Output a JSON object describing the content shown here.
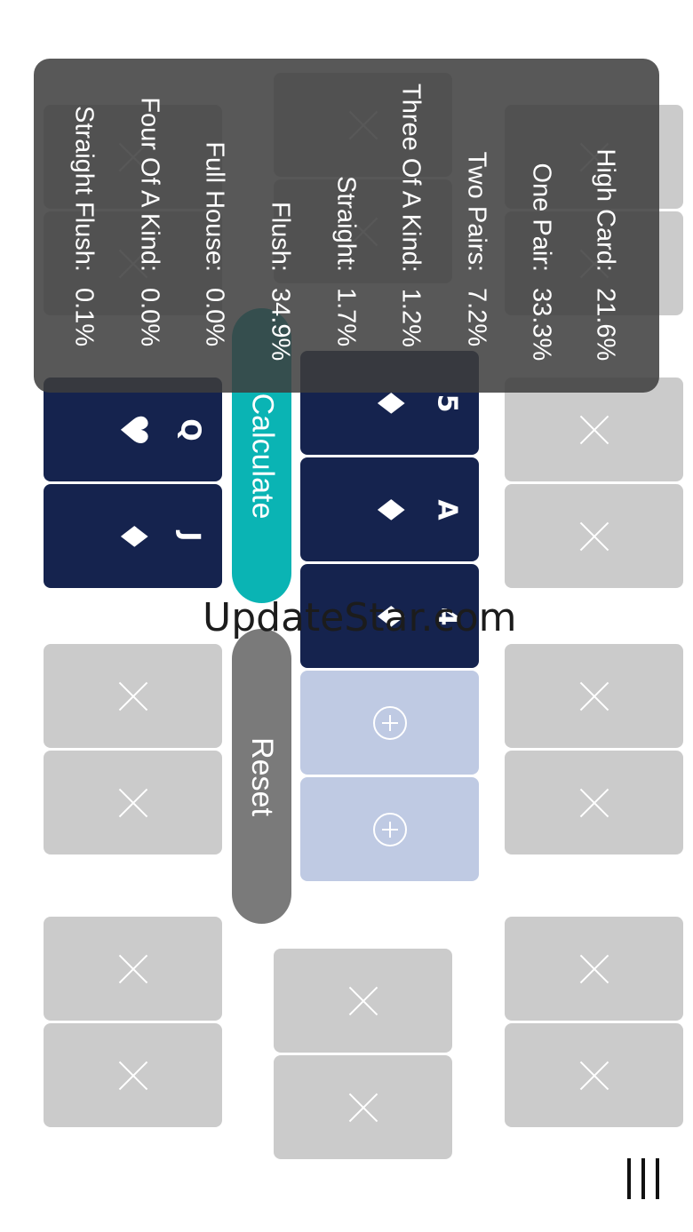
{
  "stats": {
    "rows": [
      {
        "label": "High Card:",
        "value": "21.6%"
      },
      {
        "label": "One Pair:",
        "value": "33.3%"
      },
      {
        "label": "Two Pairs:",
        "value": "7.2%"
      },
      {
        "label": "Three Of A Kind:",
        "value": "1.2%"
      },
      {
        "label": "Straight:",
        "value": "1.7%"
      },
      {
        "label": "Flush:",
        "value": "34.9%"
      },
      {
        "label": "Full House:",
        "value": "0.0%"
      },
      {
        "label": "Four Of A Kind:",
        "value": "0.0%"
      },
      {
        "label": "Straight Flush:",
        "value": "0.1%"
      }
    ]
  },
  "board": {
    "cards": [
      {
        "rank": "5",
        "suit": "♦"
      },
      {
        "rank": "A",
        "suit": "♦"
      },
      {
        "rank": "4",
        "suit": "♦"
      }
    ]
  },
  "hand": {
    "cards": [
      {
        "rank": "Q",
        "suit": "♥"
      },
      {
        "rank": "J",
        "suit": "♦"
      }
    ]
  },
  "buttons": {
    "calculate": "Calculate",
    "reset": "Reset"
  },
  "watermark": "UpdateStar.com",
  "colors": {
    "card": "#15234e",
    "empty_slot": "#cbcbcb",
    "add_slot": "#bfcae3",
    "calculate": "#0ab4b4",
    "reset": "#7a7a7a"
  },
  "icons": {
    "empty_slot": "close-icon",
    "add_slot": "plus-circle-icon",
    "menu": "menu-icon"
  }
}
